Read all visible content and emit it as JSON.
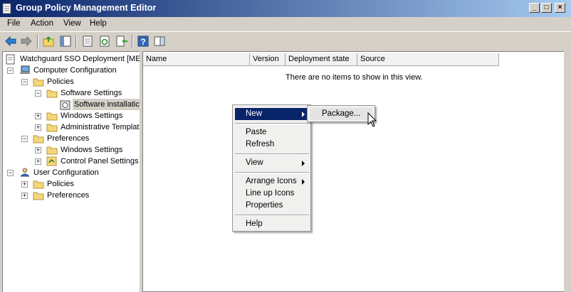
{
  "window": {
    "title": "Group Policy Management Editor",
    "buttons": [
      "_",
      "□",
      "×"
    ]
  },
  "menu": [
    "File",
    "Action",
    "View",
    "Help"
  ],
  "toolbar": [
    "back-arrow-icon",
    "forward-arrow-icon",
    "up-folder-icon",
    "show-hide-tree-icon",
    "properties-icon",
    "refresh-icon",
    "export-list-icon",
    "help-icon",
    "show-action-pane-icon"
  ],
  "tree": {
    "root": "Watchguard SSO Deployment [MEL",
    "computer_config": "Computer Configuration",
    "policies": "Policies",
    "software_settings": "Software Settings",
    "software_installation": "Software installatic",
    "windows_settings": "Windows Settings",
    "admin_templates": "Administrative Templat",
    "preferences": "Preferences",
    "windows_settings_pref": "Windows Settings",
    "control_panel": "Control Panel Settings",
    "user_config": "User Configuration",
    "user_policies": "Policies",
    "user_preferences": "Preferences"
  },
  "list": {
    "columns": [
      "Name",
      "Version",
      "Deployment state",
      "Source"
    ],
    "empty_message": "There are no items to show in this view."
  },
  "context_menu": {
    "new": "New",
    "paste": "Paste",
    "refresh": "Refresh",
    "view": "View",
    "arrange_icons": "Arrange Icons",
    "line_up_icons": "Line up Icons",
    "properties": "Properties",
    "help": "Help"
  },
  "submenu": {
    "package": "Package..."
  },
  "colors": {
    "title_start": "#0a246a",
    "title_end": "#a6caf0",
    "highlight": "#0a246a",
    "chrome": "#d4d0c8"
  }
}
